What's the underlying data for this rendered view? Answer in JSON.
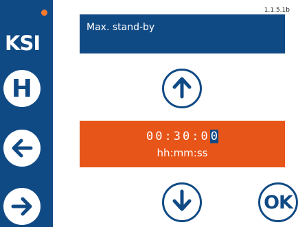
{
  "brand": {
    "logo": "KSI"
  },
  "version": "1.1.5.1b",
  "title": "Max. stand-by",
  "value": {
    "time_prefix": "00:30:0",
    "time_cursor": "0",
    "unit": "hh:mm:ss"
  },
  "buttons": {
    "home": "H",
    "ok": "OK"
  },
  "icons": {
    "up": "arrow-up-icon",
    "down": "arrow-down-icon",
    "back": "arrow-left-icon",
    "forward": "arrow-right-icon"
  },
  "colors": {
    "primary": "#104a85",
    "accent": "#e85519",
    "indicator": "#ff7a2a"
  }
}
